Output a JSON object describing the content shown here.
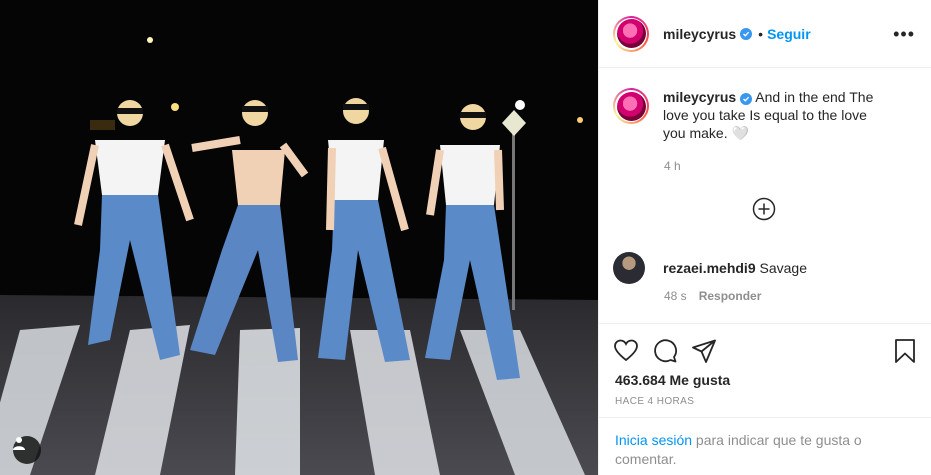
{
  "header": {
    "username": "mileycyrus",
    "separator": "•",
    "follow_label": "Seguir",
    "more_label": "•••"
  },
  "caption": {
    "username": "mileycyrus",
    "text": "And in the end The love you take Is equal to the love you make. 🤍",
    "time": "4 h"
  },
  "comment": {
    "username": "rezaei.mehdi9",
    "text": "Savage",
    "time": "48 s",
    "reply_label": "Responder"
  },
  "likes": "463.684 Me gusta",
  "posted_ago": "HACE 4 HORAS",
  "login_prompt": {
    "link": "Inicia sesión",
    "rest": " para indicar que te gusta o comentar."
  },
  "icons": {
    "verified": "verified-badge-icon",
    "add_comment": "plus-circle-icon",
    "like": "heart-icon",
    "comment": "comment-bubble-icon",
    "share": "paper-plane-icon",
    "save": "bookmark-icon",
    "tag": "user-tag-icon"
  },
  "colors": {
    "link": "#0095f6",
    "verified": "#3897f0",
    "muted": "#8e8e8e"
  }
}
